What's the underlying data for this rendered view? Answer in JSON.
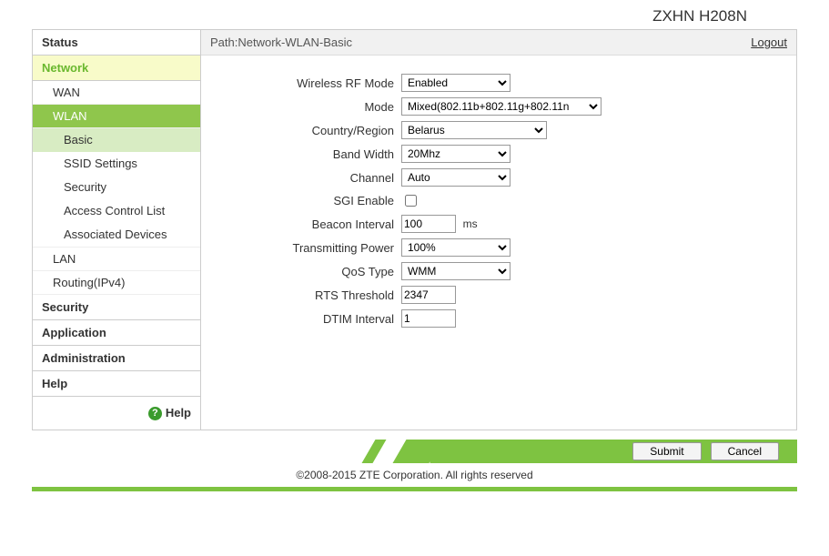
{
  "model": "ZXHN H208N",
  "path_label": "Path:",
  "path_value": "Network-WLAN-Basic",
  "logout": "Logout",
  "sidebar": {
    "items": [
      {
        "label": "Status"
      },
      {
        "label": "Network"
      },
      {
        "label": "Security"
      },
      {
        "label": "Application"
      },
      {
        "label": "Administration"
      },
      {
        "label": "Help"
      }
    ],
    "network_sub": [
      {
        "label": "WAN"
      },
      {
        "label": "WLAN"
      },
      {
        "label": "LAN"
      },
      {
        "label": "Routing(IPv4)"
      }
    ],
    "wlan_sub": [
      {
        "label": "Basic"
      },
      {
        "label": "SSID Settings"
      },
      {
        "label": "Security"
      },
      {
        "label": "Access Control List"
      },
      {
        "label": "Associated Devices"
      }
    ]
  },
  "help_text": "Help",
  "form": {
    "wireless_rf_mode": {
      "label": "Wireless RF Mode",
      "value": "Enabled"
    },
    "mode": {
      "label": "Mode",
      "value": "Mixed(802.11b+802.11g+802.11n"
    },
    "country": {
      "label": "Country/Region",
      "value": "Belarus"
    },
    "band_width": {
      "label": "Band Width",
      "value": "20Mhz"
    },
    "channel": {
      "label": "Channel",
      "value": "Auto"
    },
    "sgi": {
      "label": "SGI Enable",
      "checked": false
    },
    "beacon": {
      "label": "Beacon Interval",
      "value": "100",
      "unit": "ms"
    },
    "tx_power": {
      "label": "Transmitting Power",
      "value": "100%"
    },
    "qos": {
      "label": "QoS Type",
      "value": "WMM"
    },
    "rts": {
      "label": "RTS Threshold",
      "value": "2347"
    },
    "dtim": {
      "label": "DTIM Interval",
      "value": "1"
    }
  },
  "buttons": {
    "submit": "Submit",
    "cancel": "Cancel"
  },
  "copyright": "©2008-2015 ZTE Corporation. All rights reserved"
}
